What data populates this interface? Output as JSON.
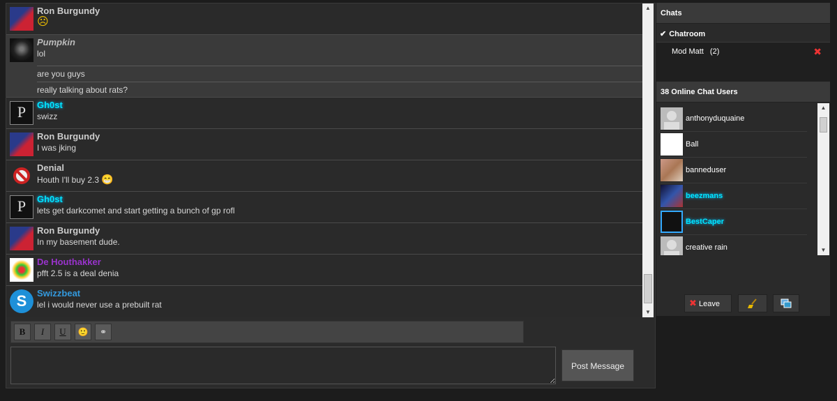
{
  "messages": [
    {
      "user": "Ron Burgundy",
      "text": "☹",
      "color": "#cccccc"
    },
    {
      "user": "Pumpkin",
      "text": "lol",
      "extra": [
        "are you guys",
        "really talking about rats?"
      ],
      "color": "#cccccc"
    },
    {
      "user": "Gh0st",
      "text": "swizz",
      "color": "#00e5ff"
    },
    {
      "user": "Ron Burgundy",
      "text": "I was jking",
      "color": "#cccccc"
    },
    {
      "user": "Denial",
      "text": "Houth I'll buy 2.3",
      "emoji": "😁",
      "color": "#cccccc"
    },
    {
      "user": "Gh0st",
      "text": "lets get darkcomet and start getting a bunch of gp rofl",
      "color": "#00e5ff"
    },
    {
      "user": "Ron Burgundy",
      "text": "In my basement dude.",
      "color": "#cccccc"
    },
    {
      "user": "De Houthakker",
      "text": "pfft 2.5 is a deal denia",
      "color": "#9933cc"
    },
    {
      "user": "Swizzbeat",
      "text": "lel i would never use a prebuilt rat",
      "color": "#3399dd"
    }
  ],
  "toolbar": {
    "bold": "B",
    "italic": "I",
    "underline": "U",
    "emoji": "🙂",
    "link": "⚭"
  },
  "compose": {
    "post_label": "Post Message",
    "placeholder": ""
  },
  "sidebar": {
    "chats_header": "Chats",
    "chats": [
      {
        "check": "✔",
        "name": "Chatroom"
      },
      {
        "name": "Mod Matt",
        "count": "(2)",
        "close": "✖"
      }
    ],
    "users_header": "38 Online Chat Users",
    "users": [
      {
        "name": "anthonyduquaine",
        "color": "#ffffff"
      },
      {
        "name": "Ball",
        "color": "#ffffff"
      },
      {
        "name": "banneduser",
        "color": "#ffffff"
      },
      {
        "name": "beezmans",
        "color": "#00e5ff"
      },
      {
        "name": "BestCaper",
        "color": "#00e5ff"
      },
      {
        "name": "creative rain",
        "color": "#ffffff"
      }
    ],
    "leave_label": "Leave",
    "leave_icon": "✖"
  }
}
